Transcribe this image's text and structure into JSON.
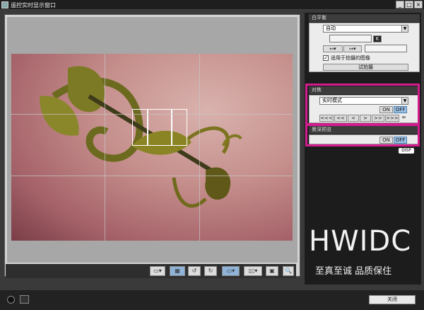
{
  "window": {
    "title": "遥控实时显示窗口"
  },
  "titlebar_buttons": {
    "minimize": "_",
    "maximize": "□",
    "close": "×"
  },
  "white_balance": {
    "header": "白平衡",
    "mode": "自动",
    "k_label": "K",
    "apply_checkbox_label": "适用于拍摄的图像",
    "apply_checked": true,
    "test_shoot_label": "试拍摄"
  },
  "focus": {
    "header": "对焦",
    "mode": "实时模式",
    "on_label": "ON",
    "off_label": "OFF",
    "off_selected": true,
    "nav_buttons": [
      "<<<",
      "<<",
      "<",
      ">",
      ">>",
      ">>>"
    ],
    "infinity": "∞"
  },
  "dof_preview": {
    "header": "景深预览",
    "on_label": "ON",
    "off_label": "OFF",
    "off_selected": true,
    "disp_label": "DISP"
  },
  "footer": {
    "close_label": "关闭"
  },
  "watermark": {
    "main": "HWIDC",
    "sub": "至真至诚 品质保住"
  },
  "colors": {
    "highlight": "#d31c8d",
    "selected_button": "#9cc1e6"
  }
}
